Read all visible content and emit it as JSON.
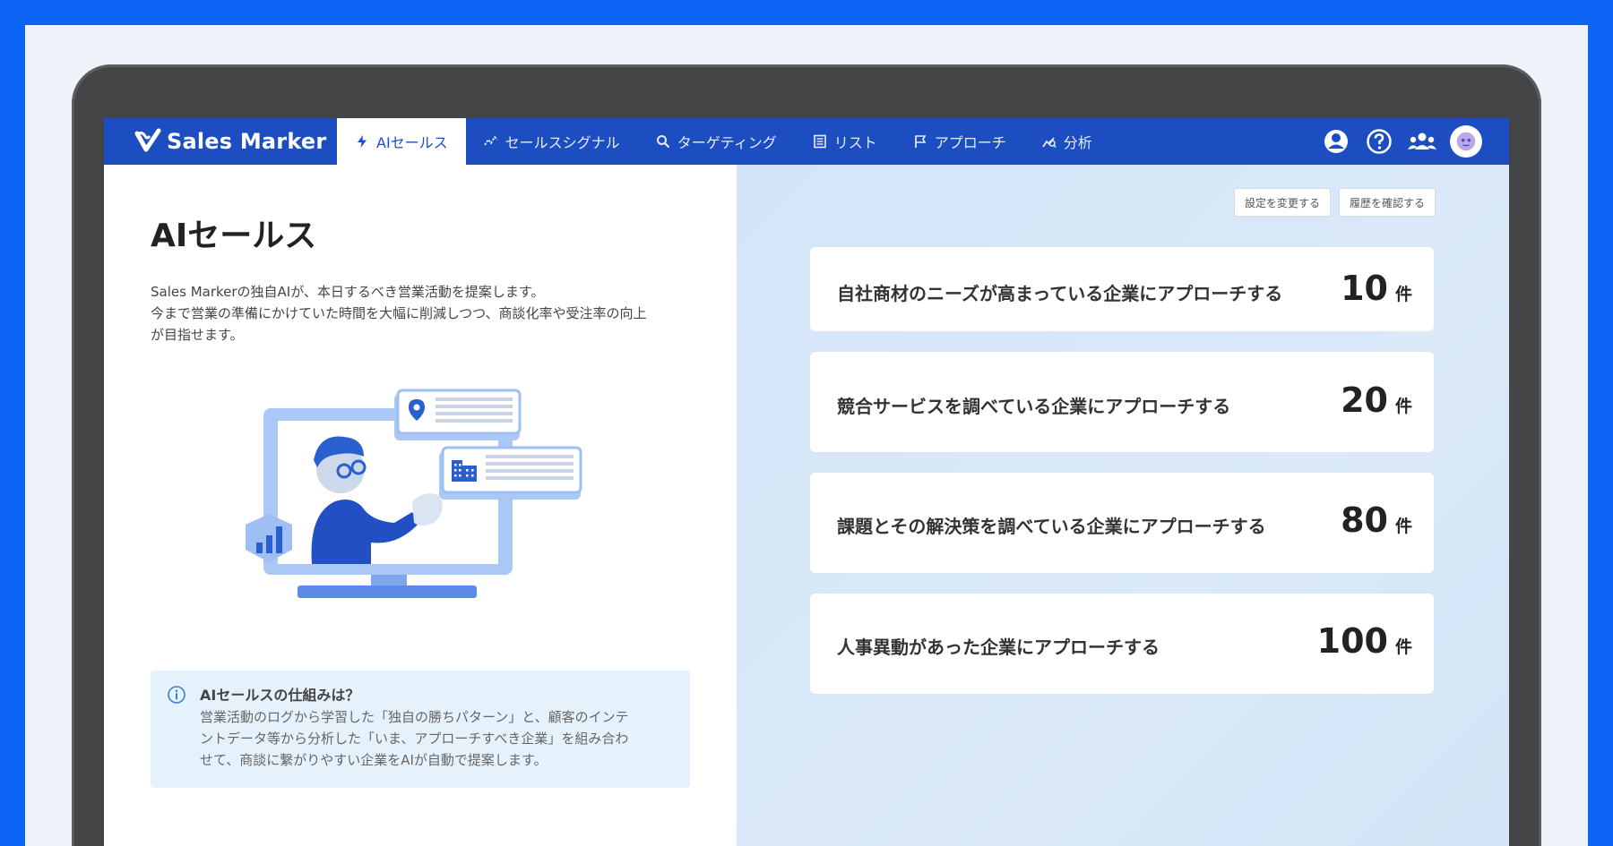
{
  "brand": {
    "name": "Sales Marker"
  },
  "nav": {
    "tabs": [
      {
        "label": "AIセールス",
        "icon": "lightning-icon",
        "active": true
      },
      {
        "label": "セールスシグナル",
        "icon": "sparkline-icon",
        "active": false
      },
      {
        "label": "ターゲティング",
        "icon": "search-icon",
        "active": false
      },
      {
        "label": "リスト",
        "icon": "list-icon",
        "active": false
      },
      {
        "label": "アプローチ",
        "icon": "flag-icon",
        "active": false
      },
      {
        "label": "分析",
        "icon": "analytics-icon",
        "active": false
      }
    ],
    "right_icons": [
      "account-icon",
      "help-icon",
      "team-icon",
      "avatar"
    ]
  },
  "left": {
    "title": "AIセールス",
    "intro_lines": [
      "Sales Markerの独自AIが、本日するべき営業活動を提案します。",
      "今まで営業の準備にかけていた時間を大幅に削減しつつ、商談化率や受注率の向上",
      "が目指せます。"
    ],
    "info": {
      "title": "AIセールスの仕組みは？",
      "lines": [
        "営業活動のログから学習した「独自の勝ちパターン」と、顧客のインテ",
        "ントデータ等から分析した「いま、アプローチすべき企業」を組み合わ",
        "せて、商談に繋がりやすい企業をAIが自動で提案します。"
      ]
    }
  },
  "right": {
    "buttons": {
      "settings": "設定を変更する",
      "history": "履歴を確認する"
    },
    "cards": [
      {
        "label": "自社商材のニーズが高まっている企業にアプローチする",
        "count": "10",
        "unit": "件"
      },
      {
        "label": "競合サービスを調べている企業にアプローチする",
        "count": "20",
        "unit": "件"
      },
      {
        "label": "課題とその解決策を調べている企業にアプローチする",
        "count": "80",
        "unit": "件"
      },
      {
        "label": "人事異動があった企業にアプローチする",
        "count": "100",
        "unit": "件"
      }
    ]
  },
  "colors": {
    "frame": "#0b64f4",
    "nav": "#1c4ec1",
    "accent": "#1c4ec1",
    "right_pane": "#d8e7f8"
  }
}
